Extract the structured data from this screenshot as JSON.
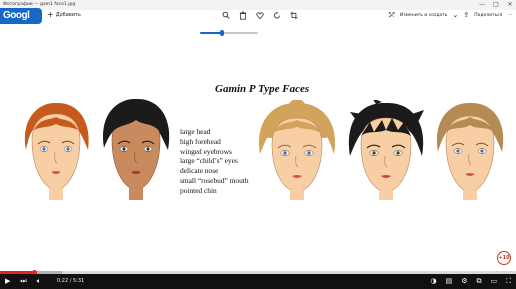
{
  "window": {
    "title": "Фотографии — gam1 face1.jpg",
    "controls": [
      "—",
      "□",
      "✕"
    ]
  },
  "toolbar": {
    "brand_label": "Googl",
    "add_label": "Добавить",
    "add_icon": "plus-icon",
    "icons": [
      "zoom-icon",
      "delete-icon",
      "favorite-icon",
      "rotate-icon",
      "crop-icon"
    ],
    "edit_label": "Изменить и создать",
    "share_label": "Поделиться",
    "more_label": "⋯"
  },
  "zoom": {
    "level": 0.38
  },
  "slide": {
    "title": "Gamin P Type Faces",
    "traits": [
      "large head",
      "high forehead",
      "winged eyebrows",
      "large “child’s” eyes",
      "delicate nose",
      "small “rosebud” mouth",
      "pointed chin"
    ],
    "colors": {
      "skin_light": "#f8cfa5",
      "skin_tan": "#c98a5e",
      "hair_red": "#c65a1c",
      "hair_black": "#1b1b1b",
      "hair_blonde": "#d2a35b",
      "hair_sandy": "#b48a55"
    }
  },
  "player": {
    "time": "0:22 / 5:31",
    "progress": 0.066,
    "loaded": 0.12,
    "accent": "#e8231a",
    "badge": "+10"
  }
}
